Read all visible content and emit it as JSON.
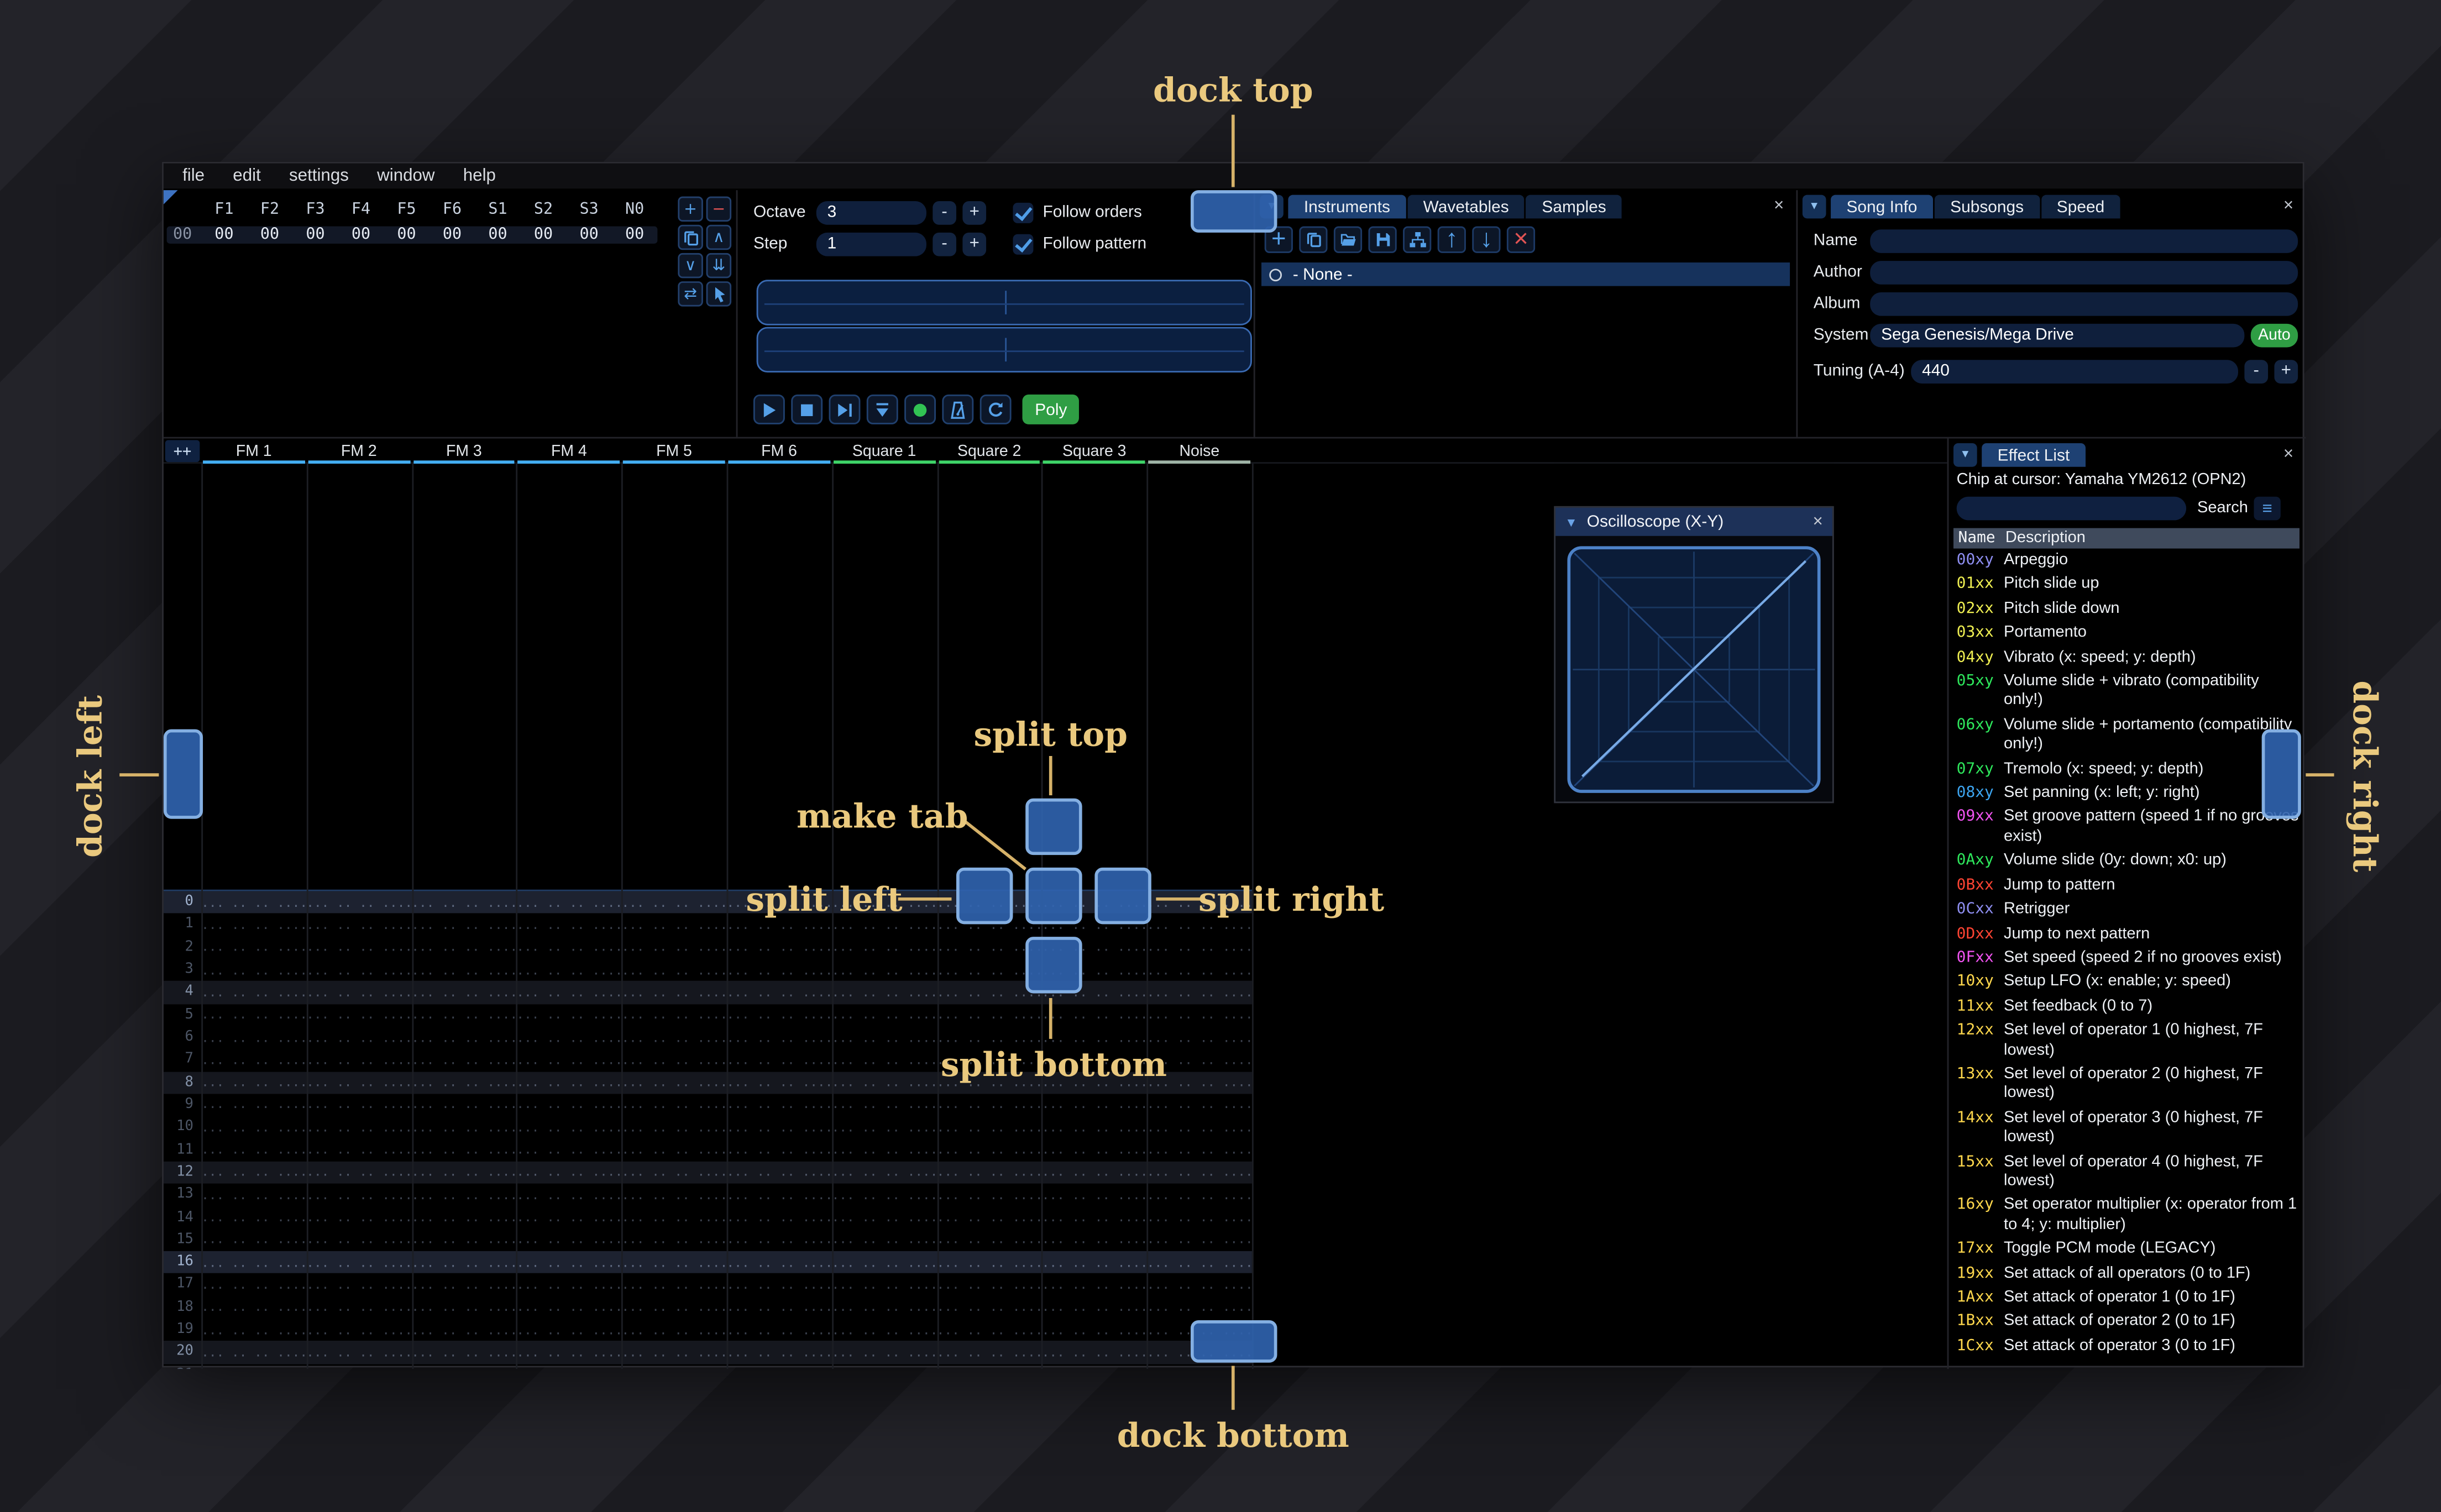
{
  "icons": {
    "close": "×",
    "collapse": "▼"
  },
  "window": {
    "menu": [
      "file",
      "edit",
      "settings",
      "window",
      "help"
    ]
  },
  "orders": {
    "row_index": "00",
    "columns": [
      "F1",
      "F2",
      "F3",
      "F4",
      "F5",
      "F6",
      "S1",
      "S2",
      "S3",
      "N0"
    ],
    "values": [
      "00",
      "00",
      "00",
      "00",
      "00",
      "00",
      "00",
      "00",
      "00",
      "00"
    ],
    "buttons": [
      {
        "name": "add-order",
        "icon": "plus",
        "accent": "blue"
      },
      {
        "name": "remove-order",
        "icon": "minus",
        "accent": "red"
      },
      {
        "name": "duplicate-order",
        "icon": "copy",
        "accent": "blue"
      },
      {
        "name": "move-order-up",
        "icon": "chevron-up",
        "accent": "blue"
      },
      {
        "name": "move-order-down",
        "icon": "chevron-down",
        "accent": "blue"
      },
      {
        "name": "duplicate-order-to-end",
        "icon": "double-down",
        "accent": "blue"
      },
      {
        "name": "change-all-orders",
        "icon": "swap",
        "accent": "blue"
      },
      {
        "name": "order-edit-mode",
        "icon": "cursor",
        "accent": "blue"
      }
    ]
  },
  "controls": {
    "octave": {
      "label": "Octave",
      "value": "3"
    },
    "step": {
      "label": "Step",
      "value": "1"
    },
    "spin_minus": "-",
    "spin_plus": "+",
    "follow_orders": "Follow orders",
    "follow_pattern": "Follow pattern",
    "transport": [
      {
        "name": "play",
        "icon": "play",
        "accent": "blue"
      },
      {
        "name": "stop",
        "icon": "stop",
        "accent": "blue"
      },
      {
        "name": "play-pattern",
        "icon": "play-pattern",
        "accent": "blue"
      },
      {
        "name": "step-one-row",
        "icon": "step-down",
        "accent": "blue"
      },
      {
        "name": "edit-record-toggle",
        "icon": "record",
        "accent": "green"
      },
      {
        "name": "metronome",
        "icon": "metronome",
        "accent": "blue"
      },
      {
        "name": "repeat-pattern",
        "icon": "repeat",
        "accent": "blue"
      }
    ],
    "poly_label": "Poly"
  },
  "instruments": {
    "tabs": [
      {
        "label": "Instruments",
        "active": true
      },
      {
        "label": "Wavetables",
        "active": false
      },
      {
        "label": "Samples",
        "active": false
      }
    ],
    "toolbar": [
      {
        "name": "add-instrument",
        "icon": "plus",
        "accent": "blue"
      },
      {
        "name": "duplicate-instrument",
        "icon": "copy",
        "accent": "blue"
      },
      {
        "name": "open-instrument",
        "icon": "folder",
        "accent": "blue"
      },
      {
        "name": "save-instrument",
        "icon": "save",
        "accent": "blue"
      },
      {
        "name": "instrument-organizer",
        "icon": "sitemap",
        "accent": "blue"
      },
      {
        "name": "move-instrument-up",
        "icon": "arrow-up",
        "accent": "blue"
      },
      {
        "name": "move-instrument-down",
        "icon": "arrow-down",
        "accent": "blue"
      },
      {
        "name": "delete-instrument",
        "icon": "close",
        "accent": "red"
      }
    ],
    "list": [
      {
        "label": "- None -",
        "selected": true
      }
    ]
  },
  "song_info": {
    "tabs": [
      {
        "label": "Song Info",
        "active": true
      },
      {
        "label": "Subsongs",
        "active": false
      },
      {
        "label": "Speed",
        "active": false
      }
    ],
    "fields": [
      {
        "label": "Name",
        "value": ""
      },
      {
        "label": "Author",
        "value": ""
      },
      {
        "label": "Album",
        "value": ""
      }
    ],
    "system": {
      "label": "System",
      "value": "Sega Genesis/Mega Drive",
      "auto_label": "Auto"
    },
    "tuning": {
      "label": "Tuning (A-4)",
      "value": "440",
      "minus": "-",
      "plus": "+"
    }
  },
  "pattern": {
    "expand_label": "++",
    "channels": [
      {
        "name": "FM 1",
        "type": "fm"
      },
      {
        "name": "FM 2",
        "type": "fm"
      },
      {
        "name": "FM 3",
        "type": "fm"
      },
      {
        "name": "FM 4",
        "type": "fm"
      },
      {
        "name": "FM 5",
        "type": "fm"
      },
      {
        "name": "FM 6",
        "type": "fm"
      },
      {
        "name": "Square 1",
        "type": "square"
      },
      {
        "name": "Square 2",
        "type": "square"
      },
      {
        "name": "Square 3",
        "type": "square"
      },
      {
        "name": "Noise",
        "type": "noise"
      }
    ],
    "type_colors": {
      "fm": "#43aef2",
      "square": "#3fd468",
      "noise": "#9fb4a6"
    },
    "visible_rows": 22,
    "empty_cell": "... .. .. ...."
  },
  "oscilloscope": {
    "title": "Oscilloscope (X-Y)"
  },
  "effect_list": {
    "tab_label": "Effect List",
    "chip_line": "Chip at cursor: Yamaha YM2612 (OPN2)",
    "search_label": "Search",
    "columns": {
      "name": "Name",
      "description": "Description"
    },
    "type_colors": {
      "misc": "#8f8ff2",
      "pitch": "#f0f052",
      "volume": "#2ee85c",
      "panning": "#3da5f0",
      "speed": "#f254f2",
      "song": "#ff4433",
      "chip": "#ffd84d"
    },
    "effects": [
      {
        "name": "00xy",
        "desc": "Arpeggio",
        "type": "misc"
      },
      {
        "name": "01xx",
        "desc": "Pitch slide up",
        "type": "pitch"
      },
      {
        "name": "02xx",
        "desc": "Pitch slide down",
        "type": "pitch"
      },
      {
        "name": "03xx",
        "desc": "Portamento",
        "type": "pitch"
      },
      {
        "name": "04xy",
        "desc": "Vibrato (x: speed; y: depth)",
        "type": "pitch"
      },
      {
        "name": "05xy",
        "desc": "Volume slide + vibrato (compatibility only!)",
        "type": "volume"
      },
      {
        "name": "06xy",
        "desc": "Volume slide + portamento (compatibility only!)",
        "type": "volume"
      },
      {
        "name": "07xy",
        "desc": "Tremolo (x: speed; y: depth)",
        "type": "volume"
      },
      {
        "name": "08xy",
        "desc": "Set panning (x: left; y: right)",
        "type": "panning"
      },
      {
        "name": "09xx",
        "desc": "Set groove pattern (speed 1 if no grooves exist)",
        "type": "speed"
      },
      {
        "name": "0Axy",
        "desc": "Volume slide (0y: down; x0: up)",
        "type": "volume"
      },
      {
        "name": "0Bxx",
        "desc": "Jump to pattern",
        "type": "song"
      },
      {
        "name": "0Cxx",
        "desc": "Retrigger",
        "type": "misc"
      },
      {
        "name": "0Dxx",
        "desc": "Jump to next pattern",
        "type": "song"
      },
      {
        "name": "0Fxx",
        "desc": "Set speed (speed 2 if no grooves exist)",
        "type": "speed"
      },
      {
        "name": "10xy",
        "desc": "Setup LFO (x: enable; y: speed)",
        "type": "chip"
      },
      {
        "name": "11xx",
        "desc": "Set feedback (0 to 7)",
        "type": "chip"
      },
      {
        "name": "12xx",
        "desc": "Set level of operator 1 (0 highest, 7F lowest)",
        "type": "chip"
      },
      {
        "name": "13xx",
        "desc": "Set level of operator 2 (0 highest, 7F lowest)",
        "type": "chip"
      },
      {
        "name": "14xx",
        "desc": "Set level of operator 3 (0 highest, 7F lowest)",
        "type": "chip"
      },
      {
        "name": "15xx",
        "desc": "Set level of operator 4 (0 highest, 7F lowest)",
        "type": "chip"
      },
      {
        "name": "16xy",
        "desc": "Set operator multiplier (x: operator from 1 to 4; y: multiplier)",
        "type": "chip"
      },
      {
        "name": "17xx",
        "desc": "Toggle PCM mode (LEGACY)",
        "type": "chip"
      },
      {
        "name": "19xx",
        "desc": "Set attack of all operators (0 to 1F)",
        "type": "chip"
      },
      {
        "name": "1Axx",
        "desc": "Set attack of operator 1 (0 to 1F)",
        "type": "chip"
      },
      {
        "name": "1Bxx",
        "desc": "Set attack of operator 2 (0 to 1F)",
        "type": "chip"
      },
      {
        "name": "1Cxx",
        "desc": "Set attack of operator 3 (0 to 1F)",
        "type": "chip"
      }
    ]
  },
  "dock_overlay": {
    "labels": {
      "dock_top": "dock top",
      "dock_left": "dock left",
      "dock_right": "dock right",
      "dock_bottom": "dock bottom",
      "split_top": "split top",
      "split_left": "split left",
      "split_right": "split right",
      "split_bottom": "split bottom",
      "make_tab": "make tab"
    },
    "label_color": "#eac97e",
    "line_color": "#d6b269",
    "button_fill": "rgba(48,100,176,0.9)",
    "button_border": "#84afe2"
  }
}
